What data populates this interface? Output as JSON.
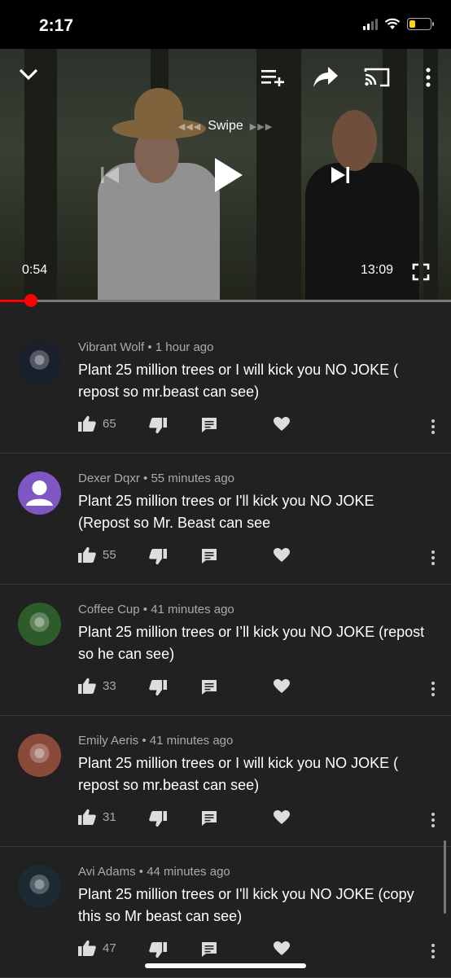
{
  "status_bar": {
    "time": "2:17"
  },
  "player": {
    "swipe_label": "Swipe",
    "current_time": "0:54",
    "duration": "13:09",
    "progress": 0.069
  },
  "comments": [
    {
      "author": "Vibrant Wolf",
      "age": "1 hour ago",
      "text": "Plant 25 million trees or I will kick you NO JOKE ( repost so mr.beast can see)",
      "likes": "65",
      "avatar_color": "#1a1f2e"
    },
    {
      "author": "Dexer Dqxr",
      "age": "55 minutes ago",
      "text": "Plant 25 million trees or I'll kick you NO JOKE (Repost so Mr. Beast can see",
      "likes": "55",
      "avatar_color": "#7e57c2"
    },
    {
      "author": "Coffee Cup",
      "age": "41 minutes ago",
      "text": "Plant 25 million trees or I’ll kick you NO JOKE (repost so he can see)",
      "likes": "33",
      "avatar_color": "#2e5b2a"
    },
    {
      "author": "Emily Aeris",
      "age": "41 minutes ago",
      "text": "Plant 25 million trees or I will kick you NO JOKE ( repost so mr.beast can see)",
      "likes": "31",
      "avatar_color": "#8a4a3a"
    },
    {
      "author": "Avi Adams",
      "age": "44 minutes ago",
      "text": "Plant 25 million trees or I'll kick you NO JOKE (copy this so Mr beast can see)",
      "likes": "47",
      "avatar_color": "#1b2a33"
    }
  ],
  "colors": {
    "progress": "#ff0000",
    "background": "#212121"
  }
}
